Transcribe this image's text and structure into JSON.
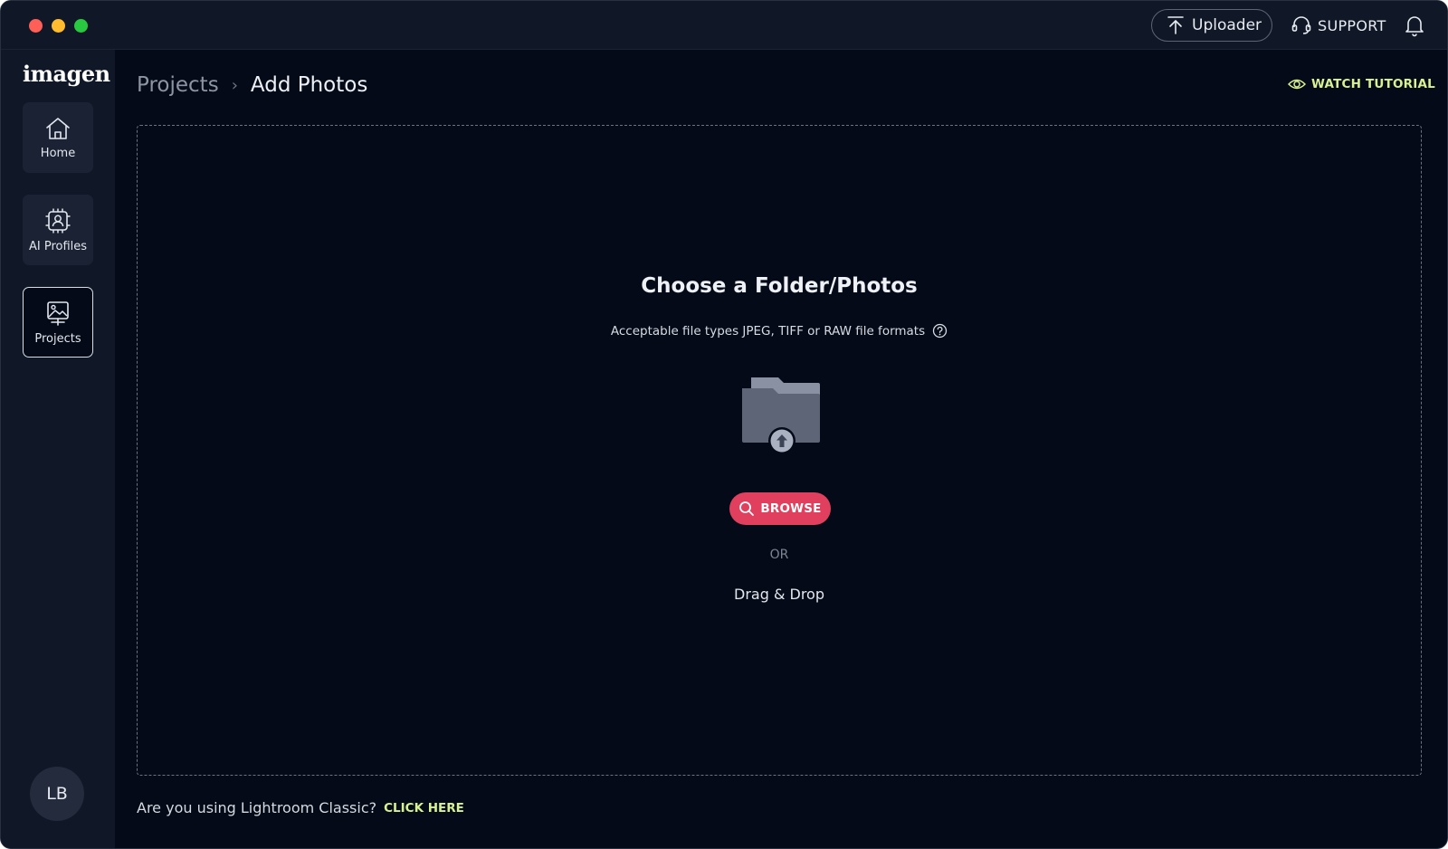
{
  "titlebar": {
    "uploader_label": "Uploader",
    "support_label": "SUPPORT"
  },
  "sidebar": {
    "logo": "imagen",
    "items": [
      {
        "label": "Home",
        "icon": "home-icon"
      },
      {
        "label": "AI Profiles",
        "icon": "ai-profile-icon"
      },
      {
        "label": "Projects",
        "icon": "projects-icon",
        "active": true
      }
    ],
    "avatar_initials": "LB"
  },
  "header": {
    "breadcrumb": {
      "parent": "Projects",
      "separator": "›",
      "current": "Add Photos"
    },
    "watch_tutorial_label": "WATCH TUTORIAL"
  },
  "dropzone": {
    "title": "Choose a Folder/Photos",
    "subtitle": "Acceptable file types JPEG, TIFF or RAW file formats",
    "browse_label": "BROWSE",
    "or_label": "OR",
    "drag_drop_label": "Drag & Drop"
  },
  "footer": {
    "question": "Are you using Lightroom Classic?",
    "link_label": "CLICK HERE"
  },
  "colors": {
    "background": "#040a18",
    "sidebar": "#101827",
    "accent_red": "#e0405e",
    "accent_lime": "#d9f291"
  }
}
